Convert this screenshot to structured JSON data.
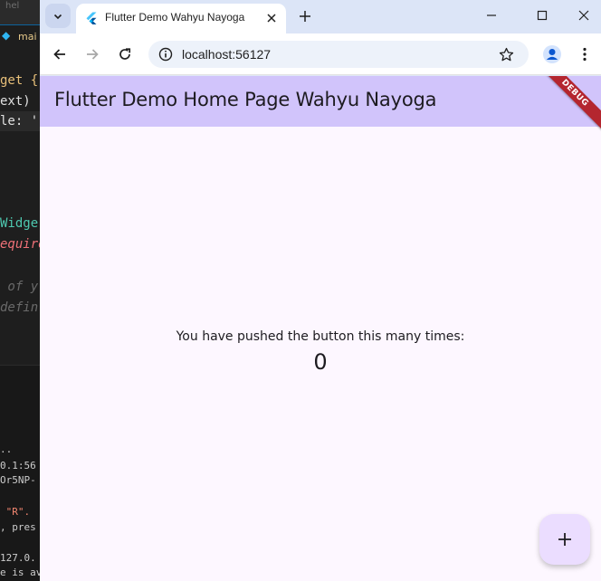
{
  "editor": {
    "search_fragment": "hel",
    "tab_label": "mai",
    "code_lines": [
      {
        "text": "get {",
        "color": "#e8c07a"
      },
      {
        "text": "ext) ",
        "color": "#e0e0e0"
      },
      {
        "text": "le: '",
        "color": "#e0e0e0"
      },
      {
        "text": "Widge",
        "color": "#4ec9b0"
      },
      {
        "text": "equire",
        "color": "#f07178"
      },
      {
        "text": " of y",
        "color": "#6a6a6a"
      },
      {
        "text": "defin",
        "color": "#6a6a6a"
      }
    ],
    "terminal_lines": [
      {
        "text": "..",
        "color": "#cccccc"
      },
      {
        "text": "0.1:56",
        "color": "#cccccc"
      },
      {
        "text": "Or5NP-",
        "color": "#cccccc"
      },
      {
        "text": " \"R\".",
        "color": "#f48771"
      },
      {
        "text": ", pres",
        "color": "#cccccc"
      },
      {
        "text": "127.0.",
        "color": "#cccccc"
      },
      {
        "text": "e is av",
        "color": "#cccccc"
      }
    ]
  },
  "browser": {
    "tab": {
      "title": "Flutter Demo Wahyu Nayoga",
      "favicon": "flutter-logo"
    },
    "address_bar": {
      "url": "localhost:56127"
    },
    "icons": {
      "tab_search": "chevron-down-icon",
      "close_tab": "close-icon",
      "new_tab": "plus-icon",
      "minimize": "minimize-icon",
      "maximize": "maximize-icon",
      "close_window": "close-icon",
      "back": "arrow-left-icon",
      "forward": "arrow-right-icon",
      "reload": "reload-icon",
      "site_info": "info-icon",
      "bookmark": "star-icon",
      "profile": "avatar-icon",
      "menu": "kebab-menu-icon"
    }
  },
  "app": {
    "title": "Flutter Demo Home Page Wahyu Nayoga",
    "debug_banner": "DEBUG",
    "counter_label": "You have pushed the button this many times:",
    "counter_value": "0",
    "fab_icon": "plus-icon",
    "colors": {
      "appbar": "#d1c4fb",
      "background": "#fdf7ff",
      "fab": "#ebddff",
      "debug_banner": "#b4262f"
    }
  }
}
